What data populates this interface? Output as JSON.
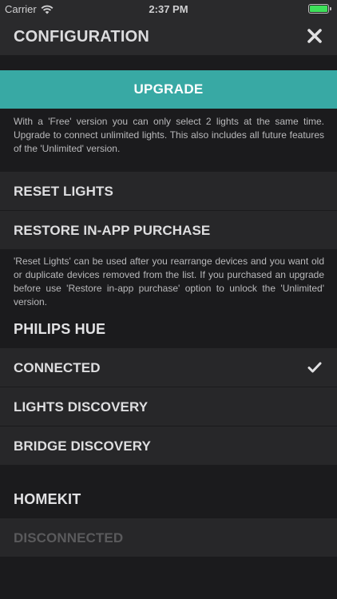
{
  "status_bar": {
    "carrier": "Carrier",
    "time": "2:37 PM",
    "battery_level": 1.0,
    "battery_color": "#3ee05a"
  },
  "header": {
    "title": "CONFIGURATION",
    "close_icon": "close-icon"
  },
  "upgrade": {
    "button_label": "UPGRADE",
    "button_color": "#38a9a4",
    "note": "With a 'Free' version you can only select 2 lights at the same time. Upgrade to connect unlimited lights. This also includes all future features of the 'Unlimited' version."
  },
  "maintenance": {
    "reset_label": "RESET LIGHTS",
    "restore_label": "RESTORE IN-APP PURCHASE",
    "note": "'Reset Lights' can be used after you rearrange devices and you want old or duplicate devices removed from the list. If you purchased an upgrade before use 'Restore in-app purchase' option to unlock the 'Unlimited' version."
  },
  "philips_hue": {
    "title": "PHILIPS HUE",
    "connected_label": "CONNECTED",
    "connected_icon": "checkmark-icon",
    "lights_discovery_label": "LIGHTS DISCOVERY",
    "bridge_discovery_label": "BRIDGE DISCOVERY"
  },
  "homekit": {
    "title": "HOMEKIT",
    "status_label": "DISCONNECTED"
  }
}
